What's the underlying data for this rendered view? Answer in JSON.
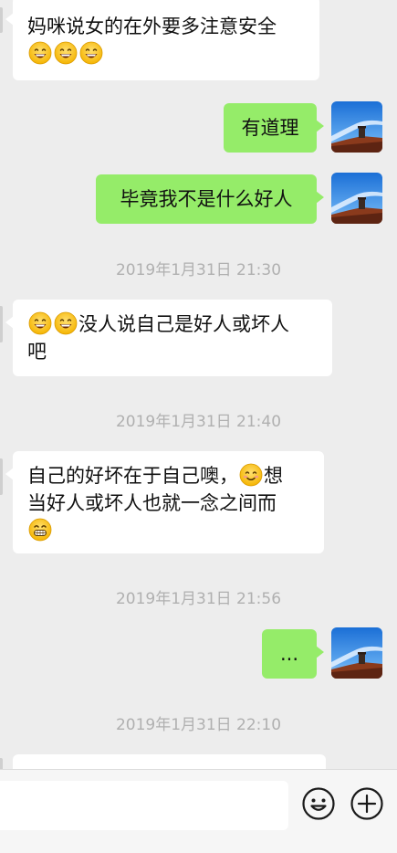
{
  "chat": {
    "messages": [
      {
        "side": "in",
        "text": "妈咪说女的在外要多注意安全",
        "emoji_count": 3
      },
      {
        "side": "out",
        "text": "有道理"
      },
      {
        "side": "out",
        "text": "毕竟我不是什么好人"
      },
      {
        "type": "time",
        "text": "2019年1月31日 21:30"
      },
      {
        "side": "in",
        "lead_emoji_count": 2,
        "text_line1": "没人说自己是好人或坏人",
        "text_line2": "吧"
      },
      {
        "type": "time",
        "text": "2019年1月31日 21:40"
      },
      {
        "side": "in",
        "text_line1": "自己的好坏在于自己噢，",
        "text_line1_tail": "想",
        "text_line2": "当好人或坏人也就一念之间而"
      },
      {
        "type": "time",
        "text": "2019年1月31日 21:56"
      },
      {
        "side": "out",
        "text": "..."
      },
      {
        "type": "time",
        "text": "2019年1月31日 22:10"
      }
    ]
  },
  "input_bar": {
    "emoji_button": "emoji-face-icon",
    "plus_button": "plus-circle-icon"
  },
  "colors": {
    "background": "#ededed",
    "out_bubble": "#95ec69",
    "in_bubble": "#ffffff",
    "timestamp": "#b0b0b0"
  }
}
